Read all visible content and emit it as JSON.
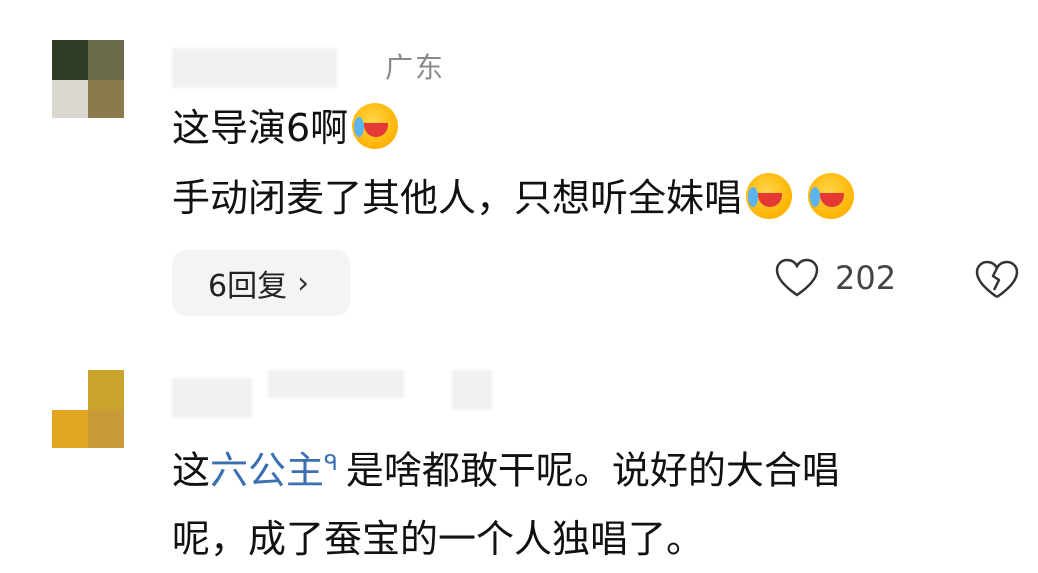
{
  "comments": [
    {
      "location": "广东",
      "lines": [
        "这导演6啊",
        "手动闭麦了其他人，只想听全妹唱"
      ],
      "reply_label": "6回复",
      "reply_chevron": "›",
      "likes": "202",
      "emoji_icon": "rolling-on-floor-laughing-icon"
    },
    {
      "text_prefix": "这",
      "link_text": "六公主",
      "search_mark": "ᑫ",
      "text_line1_rest": "是啥都敢干呢。说好的大合唱",
      "text_line2": "呢，成了蚕宝的一个人独唱了。"
    }
  ],
  "colors": {
    "link": "#3b6fb0",
    "location": "#8a8a8a",
    "reply_bg": "#f4f4f4"
  }
}
